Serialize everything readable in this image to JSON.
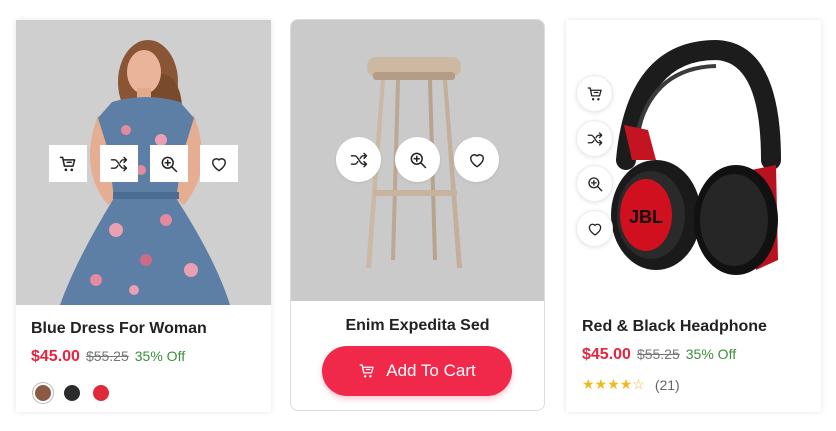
{
  "products": [
    {
      "title": "Blue Dress For Woman",
      "price": "$45.00",
      "old_price": "$55.25",
      "discount": "35% Off",
      "colors": [
        "#8a5a44",
        "#2b2b2b",
        "#e02a3c"
      ],
      "selected_color": 0,
      "actions": [
        "cart-icon",
        "shuffle-icon",
        "zoom-icon",
        "heart-icon"
      ]
    },
    {
      "title": "Enim Expedita Sed",
      "cart_label": "Add To Cart",
      "actions": [
        "shuffle-icon",
        "zoom-icon",
        "heart-icon"
      ]
    },
    {
      "title": "Red & Black Headphone",
      "price": "$45.00",
      "old_price": "$55.25",
      "discount": "35% Off",
      "rating_value": 4,
      "rating_max": 5,
      "reviews": "(21)",
      "brand_text": "JBL",
      "actions": [
        "cart-icon",
        "shuffle-icon",
        "zoom-icon",
        "heart-icon"
      ]
    }
  ],
  "colors": {
    "price": "#e5243f",
    "discount": "#3b8f3b",
    "cart_button": "#f0294a",
    "star": "#f5b81c"
  }
}
